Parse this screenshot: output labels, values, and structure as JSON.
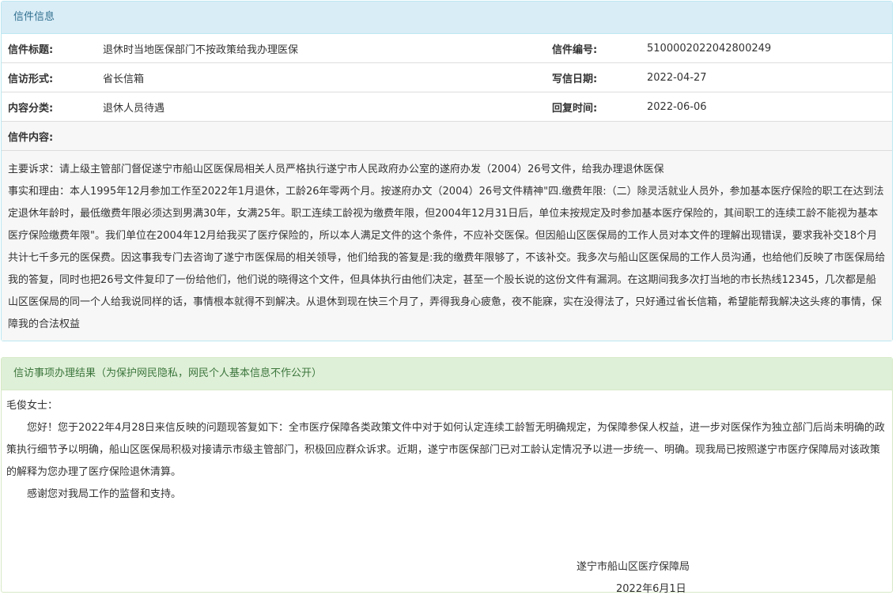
{
  "letter": {
    "heading": "信件信息",
    "title_label": "信件标题:",
    "title_value": "退休时当地医保部门不按政策给我办理医保",
    "number_label": "信件编号:",
    "number_value": "5100002022042800249",
    "form_label": "信访形式:",
    "form_value": "省长信箱",
    "date_label": "写信日期:",
    "date_value": "2022-04-27",
    "category_label": "内容分类:",
    "category_value": "退休人员待遇",
    "reply_time_label": "回复时间:",
    "reply_time_value": "2022-06-06",
    "content_label": "信件内容:",
    "content_p1": "主要诉求：请上级主管部门督促遂宁市船山区医保局相关人员严格执行遂宁市人民政府办公室的遂府办发（2004）26号文件，给我办理退休医保",
    "content_p2": "事实和理由：本人1995年12月参加工作至2022年1月退休，工龄26年零两个月。按遂府办文（2004）26号文件精神\"四.缴费年限:（二）除灵活就业人员外，参加基本医疗保险的职工在达到法定退休年龄时，最低缴费年限必须达到男满30年，女满25年。职工连续工龄视为缴费年限，但2004年12月31日后，单位未按规定及时参加基本医疗保险的，其间职工的连续工龄不能视为基本医疗保险缴费年限\"。我们单位在2004年12月给我买了医疗保险的，所以本人满足文件的这个条件，不应补交医保。但因船山区医保局的工作人员对本文件的理解出现错误，要求我补交18个月共计七千多元的医保费。因这事我专门去咨询了遂宁市医保局的相关领导，他们给我的答复是:我的缴费年限够了，不该补交。我多次与船山区医保局的工作人员沟通，也给他们反映了市医保局给我的答复，同时也把26号文件复印了一份给他们，他们说的晓得这个文件，但具体执行由他们决定，甚至一个股长说的这份文件有漏洞。在这期间我多次打当地的市长热线12345，几次都是船山区医保局的同一个人给我说同样的话，事情根本就得不到解决。从退休到现在快三个月了，弄得我身心疲惫，夜不能寐，实在没得法了，只好通过省长信箱，希望能帮我解决这头疼的事情，保障我的合法权益"
  },
  "reply": {
    "heading": "信访事项办理结果（为保护网民隐私，网民个人基本信息不作公开）",
    "salutation": "毛俊女士：",
    "p1": "您好！您于2022年4月28日来信反映的问题现答复如下：全市医疗保障各类政策文件中对于如何认定连续工龄暂无明确规定，为保障参保人权益，进一步对医保作为独立部门后尚未明确的政策执行细节予以明确，船山区医保局积极对接请示市级主管部门，积极回应群众诉求。近期，遂宁市医保部门已对工龄认定情况予以进一步统一、明确。现我局已按照遂宁市医疗保障局对该政策的解释为您办理了医疗保险退休清算。",
    "p2": "感谢您对我局工作的监督和支持。",
    "signature": "遂宁市船山区医疗保障局",
    "sign_date": "2022年6月1日"
  }
}
